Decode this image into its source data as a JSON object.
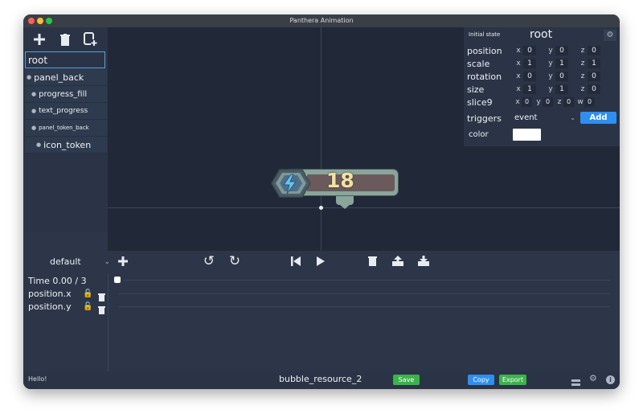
{
  "window": {
    "title": "Panthera Animation"
  },
  "toolbar": {
    "add_icon": "plus-icon",
    "delete_icon": "trash-icon",
    "duplicate_icon": "duplicate-icon"
  },
  "tree": {
    "items": [
      {
        "label": "root"
      },
      {
        "label": "panel_back"
      },
      {
        "label": "progress_fill"
      },
      {
        "label": "text_progress"
      },
      {
        "label": "panel_token_back"
      },
      {
        "label": "icon_token"
      }
    ]
  },
  "canvas": {
    "counter": "18"
  },
  "inspector": {
    "state_label": "Initial state",
    "node_name": "root",
    "position": {
      "label": "position",
      "x": "0",
      "y": "0",
      "z": "0"
    },
    "scale": {
      "label": "scale",
      "x": "1",
      "y": "1",
      "z": "1"
    },
    "rotation": {
      "label": "rotation",
      "x": "0",
      "y": "0",
      "z": "0"
    },
    "size": {
      "label": "size",
      "x": "1",
      "y": "1",
      "z": "0"
    },
    "slice9": {
      "label": "slice9",
      "x": "0",
      "y": "0",
      "z": "0",
      "w": "0"
    },
    "triggers": {
      "label": "triggers",
      "value": "event",
      "add_label": "Add"
    },
    "color": {
      "label": "color",
      "value": "#ffffff"
    },
    "axis": {
      "x": "x",
      "y": "y",
      "z": "z",
      "w": "w"
    }
  },
  "timeline": {
    "animation": "default",
    "time_label": "Time 0.00 / 3",
    "tracks": [
      {
        "label": "position.x"
      },
      {
        "label": "position.y"
      }
    ]
  },
  "statusbar": {
    "message": "Hello!",
    "file_name": "bubble_resource_2",
    "save_label": "Save",
    "copy_label": "Copy",
    "export_label": "Export"
  },
  "colors": {
    "accent_blue": "#2f8ff0",
    "accent_green": "#3bb34b",
    "counter_text": "#f2e2a2",
    "badge_teal": "#8aa59b"
  }
}
